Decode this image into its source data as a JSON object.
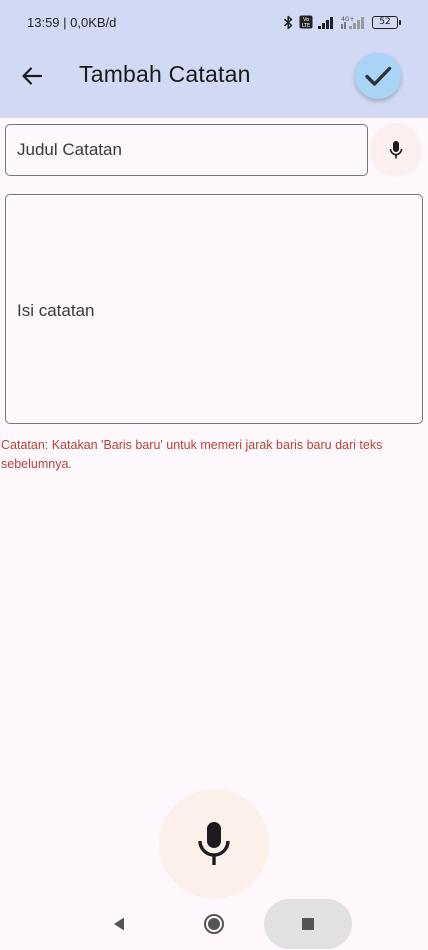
{
  "status_bar": {
    "time_speed": "13:59 | 0,0KB/d",
    "volte_label": "Vo LTE",
    "network_label": "4G+",
    "battery_level": "52"
  },
  "app_bar": {
    "title": "Tambah Catatan",
    "back_icon": "arrow-left-icon",
    "save_icon": "check-icon"
  },
  "form": {
    "title_placeholder": "Judul Catatan",
    "title_value": "",
    "content_placeholder": "Isi catatan",
    "content_value": "",
    "mic_icon": "microphone-icon"
  },
  "hint": "Catatan: Katakan 'Baris baru' untuk memeri jarak baris baru dari teks sebelumnya.",
  "colors": {
    "header_bg": "#d1d9f5",
    "page_bg": "#fef8fc",
    "save_button_bg": "#a9d4f5",
    "hint_text": "#b3443d",
    "mic_button_bg": "#fbf1ea"
  }
}
